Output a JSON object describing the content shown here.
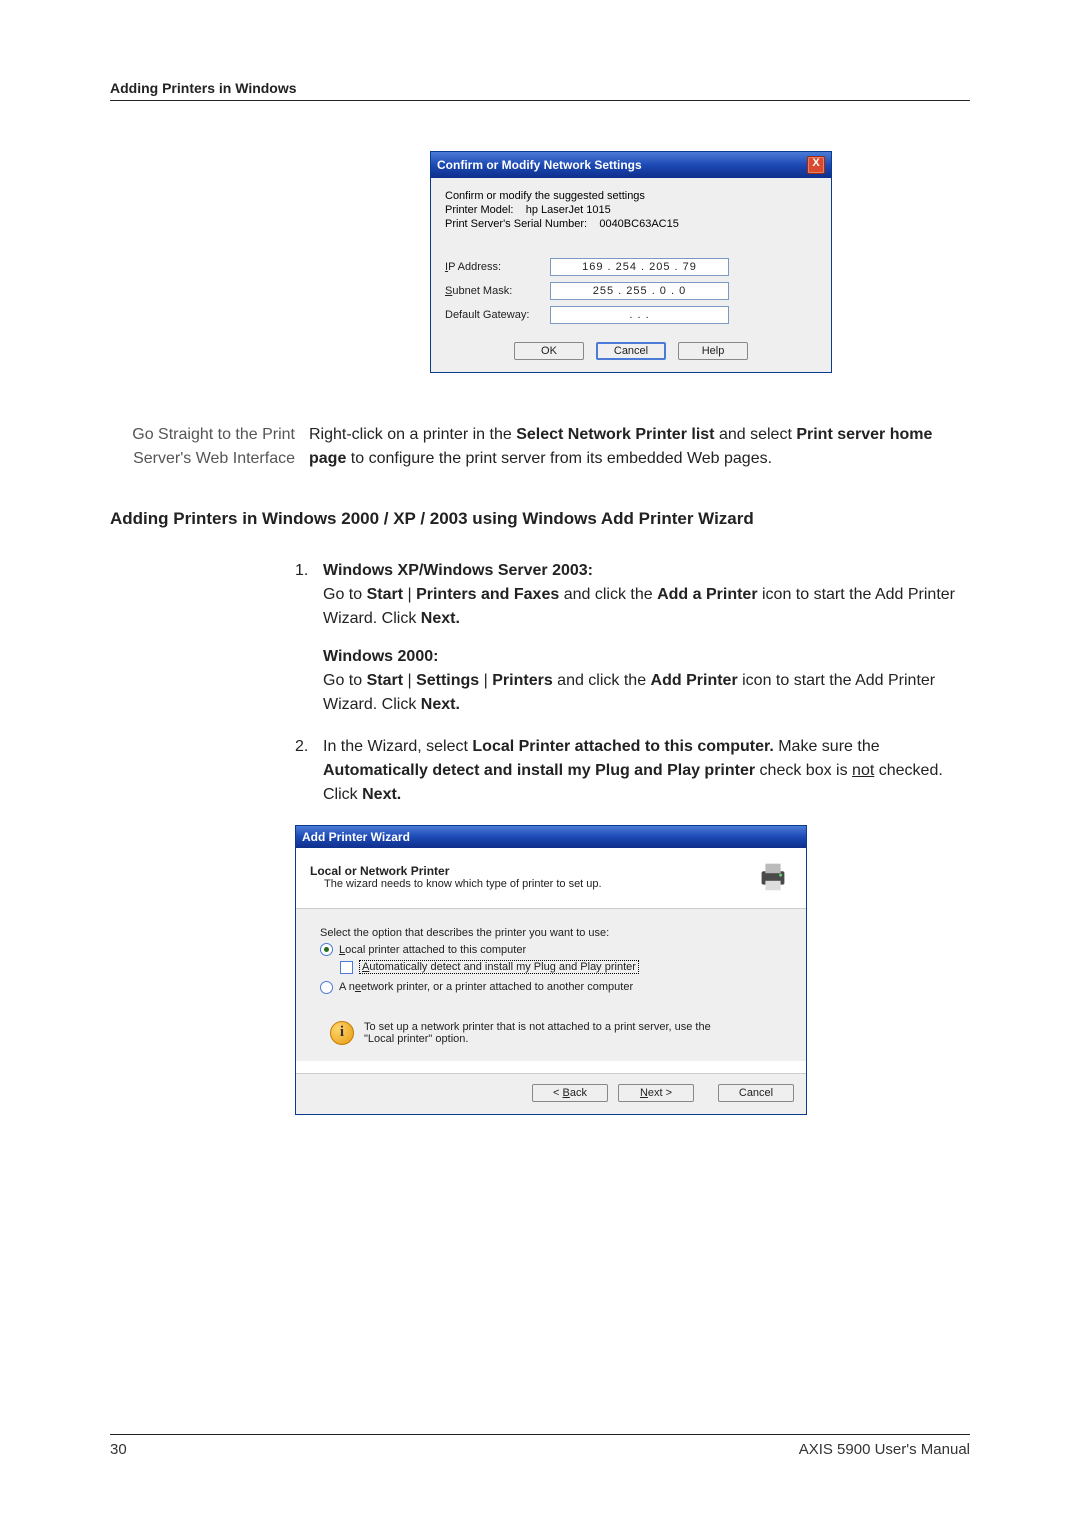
{
  "page": {
    "header": "Adding Printers in Windows",
    "page_number": "30",
    "footer_right": "AXIS 5900 User's Manual"
  },
  "dialog1": {
    "title": "Confirm or Modify Network Settings",
    "close": "X",
    "intro": "Confirm or modify the suggested settings",
    "model_label": "Printer Model:",
    "model_value": "hp LaserJet 1015",
    "serial_label": "Print Server's Serial Number:",
    "serial_value": "0040BC63AC15",
    "ip_label_pre": "I",
    "ip_label_post": "P Address:",
    "ip_value": "169 . 254 . 205 . 79",
    "subnet_label_pre": "S",
    "subnet_label_post": "ubnet Mask:",
    "subnet_value": "255 . 255 .  0  .  0",
    "gateway_label": "Default Gateway:",
    "gateway_value": ".       .       .",
    "ok": "OK",
    "cancel": "Cancel",
    "help": "Help"
  },
  "section1": {
    "side_label": "Go Straight to the Print Server's Web Interface",
    "body_pre": "Right-click on a printer in the ",
    "body_b1": "Select Network Printer list",
    "body_mid": " and select ",
    "body_b2": "Print server home page",
    "body_post": " to configure the print server from its embedded Web pages."
  },
  "heading2": "Adding Printers in Windows 2000 / XP / 2003 using Windows Add Printer Wizard",
  "steps": {
    "s1": {
      "num": "1.",
      "l1a": "Windows XP/Windows Server 2003:",
      "l1b_pre": "Go to ",
      "l1b_b1": "Start",
      "l1b_pipe": " | ",
      "l1b_b2": "Printers and Faxes",
      "l1b_mid": " and click the ",
      "l1b_b3": "Add a Printer",
      "l1b_post": " icon to start the Add Printer Wizard. Click ",
      "l1b_b4": "Next.",
      "l2a": "Windows 2000:",
      "l2b_pre": "Go to ",
      "l2b_b1": "Start",
      "l2b_p1": " | ",
      "l2b_b2": "Settings",
      "l2b_p2": " | ",
      "l2b_b3": "Printers",
      "l2b_mid": " and click the ",
      "l2b_b4": "Add Printer",
      "l2b_post": " icon to start the Add Printer Wizard. Click ",
      "l2b_b5": "Next."
    },
    "s2": {
      "num": "2.",
      "pre": "In the Wizard, select ",
      "b1": "Local Printer attached to this computer.",
      "mid1": " Make sure the ",
      "b2": "Automatically detect and install my Plug and Play printer",
      "mid2": " check box is ",
      "not": "not",
      "post": " checked. Click ",
      "b3": "Next."
    }
  },
  "dialog2": {
    "title": "Add Printer Wizard",
    "banner_title": "Local or Network Printer",
    "banner_sub": "The wizard needs to know which type of printer to set up.",
    "select_prompt": "Select the option that describes the printer you want to use:",
    "opt1_pre": "L",
    "opt1_post": "ocal printer attached to this computer",
    "opt1_chk_pre": "A",
    "opt1_chk_post": "utomatically detect and install my Plug and Play printer",
    "opt2_pre": "A n",
    "opt2_post": "etwork printer, or a printer attached to another computer",
    "info": "To set up a network printer that is not attached to a print server, use the \"Local printer\" option.",
    "back_pre": "< ",
    "back_u": "B",
    "back_post": "ack",
    "next_u": "N",
    "next_post": "ext >",
    "cancel": "Cancel"
  }
}
